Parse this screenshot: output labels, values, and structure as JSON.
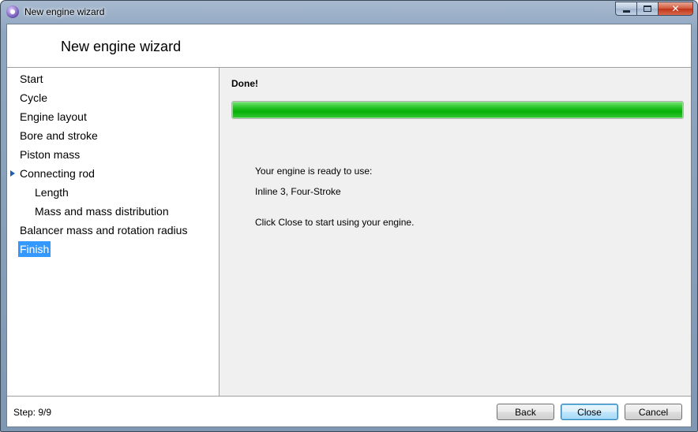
{
  "window": {
    "title": "New engine wizard"
  },
  "header": {
    "title": "New engine wizard"
  },
  "steps": [
    {
      "label": "Start",
      "level": 0,
      "current": false,
      "selected": false
    },
    {
      "label": "Cycle",
      "level": 0,
      "current": false,
      "selected": false
    },
    {
      "label": "Engine layout",
      "level": 0,
      "current": false,
      "selected": false
    },
    {
      "label": "Bore and stroke",
      "level": 0,
      "current": false,
      "selected": false
    },
    {
      "label": "Piston mass",
      "level": 0,
      "current": false,
      "selected": false
    },
    {
      "label": "Connecting rod",
      "level": 0,
      "current": true,
      "selected": false
    },
    {
      "label": "Length",
      "level": 1,
      "current": false,
      "selected": false
    },
    {
      "label": "Mass and mass distribution",
      "level": 1,
      "current": false,
      "selected": false
    },
    {
      "label": "Balancer mass and rotation radius",
      "level": 0,
      "current": false,
      "selected": false
    },
    {
      "label": "Finish",
      "level": 0,
      "current": false,
      "selected": true
    }
  ],
  "content": {
    "title": "Done!",
    "progress": 1.0,
    "ready_label": "Your engine is ready to use:",
    "engine": "Inline 3, Four-Stroke",
    "instruction": "Click Close to start using your engine."
  },
  "footer": {
    "step_text": "Step: 9/9",
    "back_label": "Back",
    "close_label": "Close",
    "cancel_label": "Cancel"
  },
  "colors": {
    "selection": "#3399ff",
    "progress_green": "#06b006",
    "current_arrow": "#1e5fb4"
  }
}
